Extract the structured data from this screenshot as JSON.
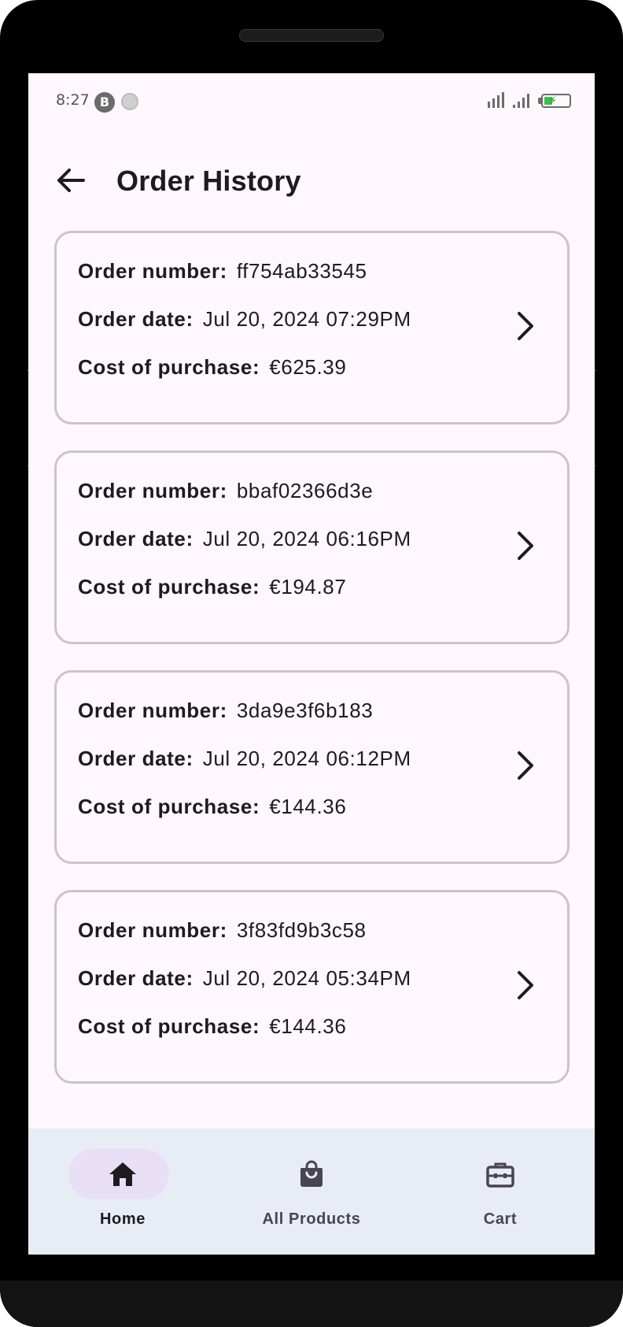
{
  "status_bar": {
    "time": "8:27",
    "badge_letter": "B"
  },
  "header": {
    "title": "Order History"
  },
  "labels": {
    "order_number": "Order number:",
    "order_date": "Order date:",
    "cost": "Cost of purchase:"
  },
  "orders": [
    {
      "number": "ff754ab33545",
      "date": "Jul 20, 2024 07:29PM",
      "cost": "€625.39"
    },
    {
      "number": "bbaf02366d3e",
      "date": "Jul 20, 2024 06:16PM",
      "cost": "€194.87"
    },
    {
      "number": "3da9e3f6b183",
      "date": "Jul 20, 2024 06:12PM",
      "cost": "€144.36"
    },
    {
      "number": "3f83fd9b3c58",
      "date": "Jul 20, 2024 05:34PM",
      "cost": "€144.36"
    }
  ],
  "nav": {
    "items": [
      {
        "label": "Home",
        "icon": "home-icon",
        "selected": true
      },
      {
        "label": "All Products",
        "icon": "shopping-bag-icon",
        "selected": false
      },
      {
        "label": "Cart",
        "icon": "briefcase-icon",
        "selected": false
      }
    ]
  },
  "colors": {
    "background": "#fef7fc",
    "card_border": "#cac4d0",
    "nav_background": "#e8ecf5",
    "nav_selected_pill": "#e8dff7",
    "text": "#1d1b20"
  }
}
